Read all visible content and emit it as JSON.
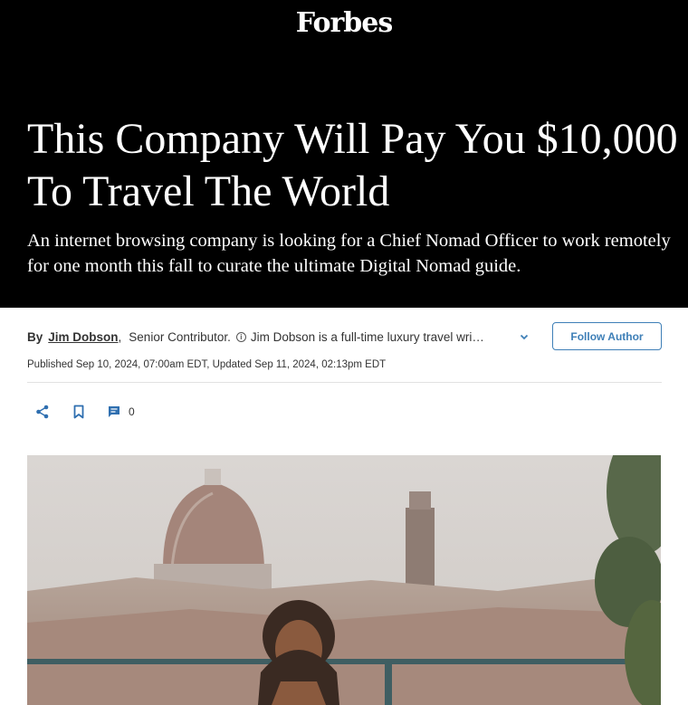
{
  "header": {
    "logo_text": "Forbes"
  },
  "article": {
    "headline": "This Company Will Pay You $10,000 To Travel The World",
    "subhead": "An internet browsing company is looking for a Chief Nomad Officer to work remotely for one month this fall to curate the ultimate Digital Nomad guide.",
    "byline": {
      "prefix": "By",
      "author": "Jim Dobson",
      "role": "Senior Contributor.",
      "bio": "Jim Dobson is a full-time luxury travel writer",
      "follow_label": "Follow Author"
    },
    "published": "Published Sep 10, 2024, 07:00am EDT, Updated Sep 11, 2024, 02:13pm EDT",
    "actions": {
      "comment_count": "0"
    }
  },
  "icons": {
    "share": "share-icon",
    "bookmark": "bookmark-icon",
    "comment": "comment-icon",
    "info": "info-icon",
    "chevron": "chevron-down-icon"
  },
  "colors": {
    "accent": "#3e7fb7",
    "hero_bg": "#000000",
    "text": "#333333"
  }
}
